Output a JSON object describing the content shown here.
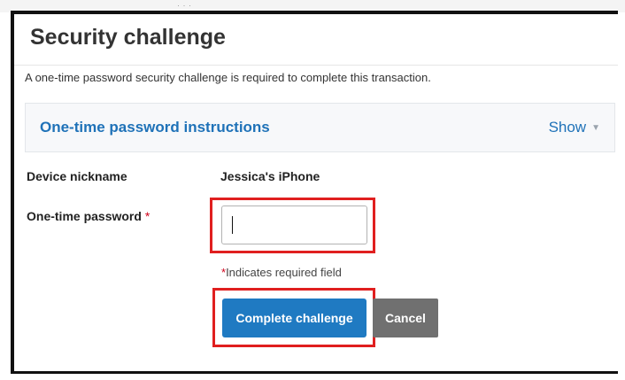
{
  "background_strip": {
    "text": "· · ·"
  },
  "dialog": {
    "title": "Security challenge",
    "description": "A one-time password security challenge is required to complete this transaction."
  },
  "instructions_panel": {
    "title": "One-time password instructions",
    "toggle_label": "Show",
    "toggle_icon": "chevron-down-icon"
  },
  "device": {
    "label": "Device nickname",
    "value": "Jessica's iPhone"
  },
  "otp": {
    "label": "One-time password",
    "required_marker": "*",
    "value": ""
  },
  "required_note": {
    "marker": "*",
    "text": "Indicates required field"
  },
  "buttons": {
    "complete_label": "Complete challenge",
    "cancel_label": "Cancel"
  },
  "colors": {
    "accent": "#1f7ac2",
    "link": "#1f72b8",
    "required": "#d0021b",
    "highlight_box": "#e01f1f",
    "cancel": "#707070"
  }
}
